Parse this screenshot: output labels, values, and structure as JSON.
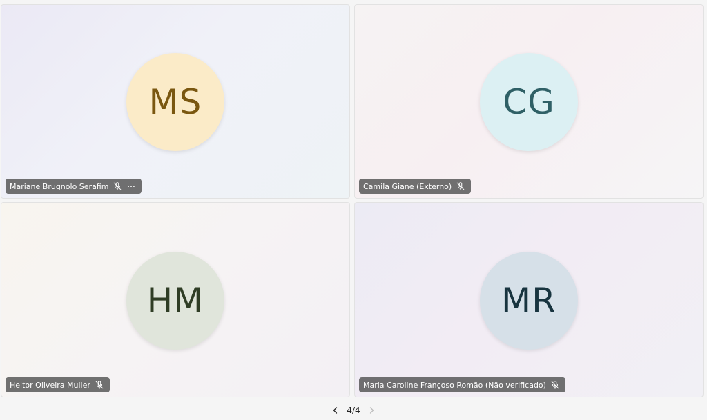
{
  "tiles": [
    {
      "initials": "MS",
      "name": "Mariane Brugnolo Serafim",
      "avatar_bg": "#fbebc8",
      "avatar_fg": "#7a5710",
      "mic": "mic-off-icon",
      "has_more": true
    },
    {
      "initials": "CG",
      "name": "Camila Giane (Externo)",
      "avatar_bg": "#dcf0f3",
      "avatar_fg": "#2f6066",
      "mic": "mic-off-icon",
      "has_more": false
    },
    {
      "initials": "HM",
      "name": "Heitor Oliveira Muller",
      "avatar_bg": "#e0e5db",
      "avatar_fg": "#2f3d25",
      "mic": "mic-off-icon",
      "has_more": false
    },
    {
      "initials": "MR",
      "name": "Maria Caroline Françoso Romão (Não verificado)",
      "avatar_bg": "#d6e0e8",
      "avatar_fg": "#18343f",
      "mic": "mic-off-icon",
      "has_more": false
    }
  ],
  "pager": {
    "label": "4/4",
    "prev_icon": "chevron-left-icon",
    "next_icon": "chevron-right-icon"
  }
}
